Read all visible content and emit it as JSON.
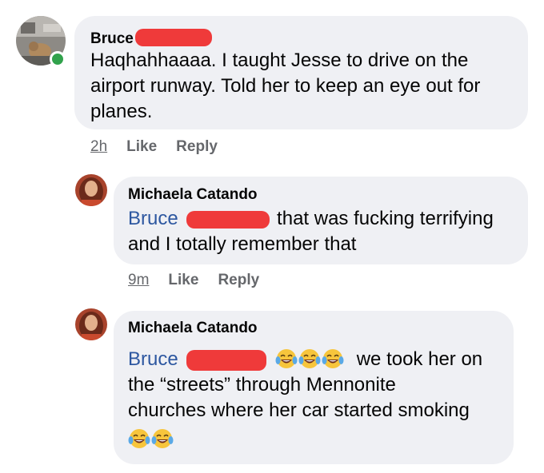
{
  "comments": [
    {
      "author": "Bruce",
      "text": "Haqhahhaaaa. I taught Jesse to drive on the airport runway. Told her to keep an eye out for planes.",
      "line1": "Haqhahhaaaa. I taught Jesse to drive on the",
      "line2": "airport runway. Told her to keep an eye out for",
      "line3": "planes.",
      "time": "2h",
      "like": "Like",
      "reply": "Reply",
      "online": true
    },
    {
      "author": "Michaela Catando",
      "mention": "Bruce",
      "line1_after": "that was fucking terrifying",
      "line2": "and I totally remember that",
      "time": "9m",
      "like": "Like",
      "reply": "Reply"
    },
    {
      "author": "Michaela Catando",
      "mention": "Bruce",
      "line1_after": "we took her on",
      "line2": "the “streets” through Mennonite",
      "line3": "churches where her car started smoking",
      "emoji_name": "face-with-tears-of-joy-emoji",
      "emoji_count_line1": 3,
      "emoji_count_line4": 2
    }
  ],
  "colors": {
    "bubble": "#eff0f4",
    "mention": "#2d57a0",
    "redaction": "#ef3a3a",
    "online": "#31a24c",
    "meta": "#65676b"
  }
}
